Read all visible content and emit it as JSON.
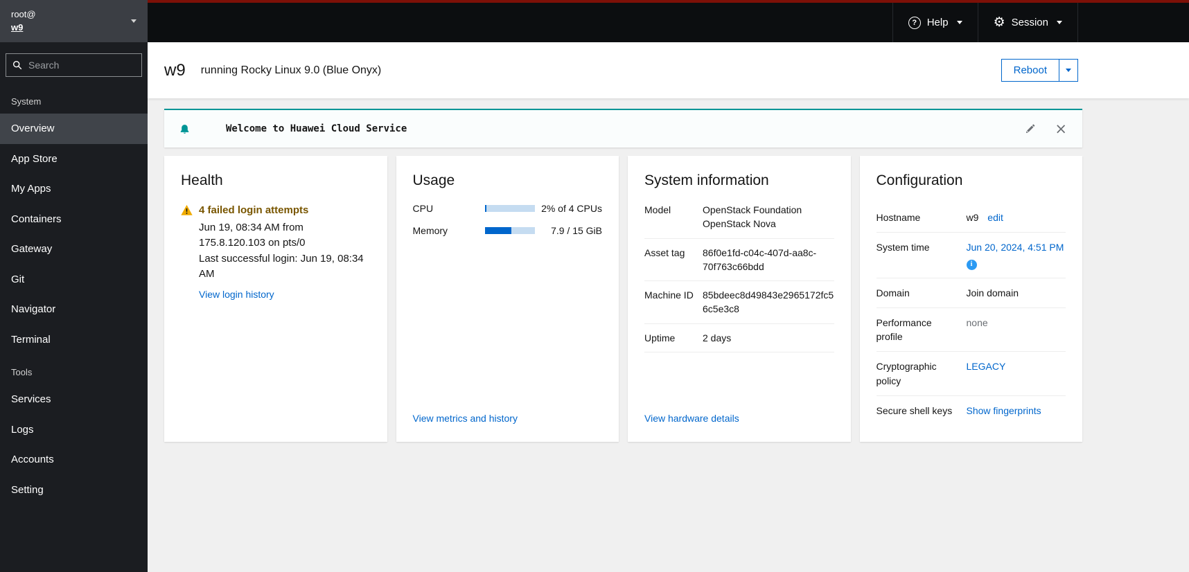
{
  "colors": {
    "accent_teal": "#009596",
    "link_blue": "#0066cc",
    "warning_yellow": "#f0ab00",
    "warning_text": "#795600",
    "danger_red": "#7d1007",
    "info_blue": "#2b9af3"
  },
  "icons": {
    "question": "?",
    "gear": "⚙",
    "close": "×"
  },
  "masthead": {
    "user": "root@",
    "host": "w9",
    "help_label": "Help",
    "session_label": "Session"
  },
  "sidebar": {
    "search_placeholder": "Search",
    "sections": [
      {
        "label": "System",
        "items": [
          "Overview",
          "App Store",
          "My Apps",
          "Containers",
          "Gateway",
          "Git",
          "Navigator",
          "Terminal"
        ]
      },
      {
        "label": "Tools",
        "items": [
          "Services",
          "Logs",
          "Accounts",
          "Setting"
        ]
      }
    ]
  },
  "page_header": {
    "hostname": "w9",
    "os_text": "running Rocky Linux 9.0 (Blue Onyx)",
    "reboot_label": "Reboot"
  },
  "banner": {
    "message": "Welcome to Huawei Cloud Service"
  },
  "cards": {
    "health": {
      "title": "Health",
      "alert_title": "4 failed login attempts",
      "alert_detail": "Jun 19, 08:34 AM from 175.8.120.103 on pts/0",
      "alert_last": "Last successful login: Jun 19, 08:34 AM",
      "link": "View login history"
    },
    "usage": {
      "title": "Usage",
      "cpu": {
        "label": "CPU",
        "text": "2% of 4 CPUs",
        "percent": 4
      },
      "memory": {
        "label": "Memory",
        "text": "7.9 / 15 GiB",
        "percent": 53
      },
      "link": "View metrics and history"
    },
    "system_info": {
      "title": "System information",
      "rows": [
        {
          "label": "Model",
          "value": "OpenStack Foundation OpenStack Nova"
        },
        {
          "label": "Asset tag",
          "value": "86f0e1fd-c04c-407d-aa8c-70f763c66bdd"
        },
        {
          "label": "Machine ID",
          "value": "85bdeec8d49843e2965172fc56c5e3c8"
        },
        {
          "label": "Uptime",
          "value": "2 days"
        }
      ],
      "link": "View hardware details"
    },
    "configuration": {
      "title": "Configuration",
      "hostname": {
        "label": "Hostname",
        "value": "w9",
        "edit_link": "edit"
      },
      "system_time": {
        "label": "System time",
        "value": "Jun 20, 2024, 4:51 PM"
      },
      "domain": {
        "label": "Domain",
        "value": "Join domain"
      },
      "performance": {
        "label": "Performance profile",
        "value": "none"
      },
      "crypto": {
        "label": "Cryptographic policy",
        "value": "LEGACY"
      },
      "ssh_keys": {
        "label": "Secure shell keys",
        "value": "Show fingerprints"
      }
    }
  }
}
